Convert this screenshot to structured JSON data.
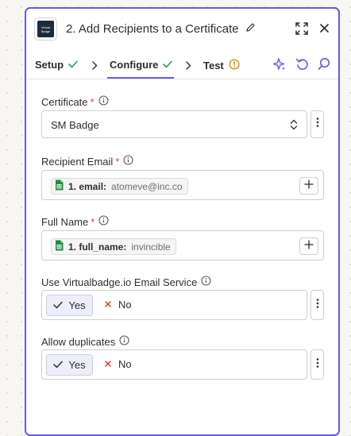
{
  "header": {
    "title": "2. Add Recipients to a Certificate",
    "logo_text_line1": "Virtual",
    "logo_text_line2": "Badge"
  },
  "tabs": [
    {
      "label": "Setup",
      "status": "complete"
    },
    {
      "label": "Configure",
      "status": "complete",
      "active": true
    },
    {
      "label": "Test",
      "status": "warning"
    }
  ],
  "fields": {
    "certificate": {
      "label": "Certificate",
      "required": true,
      "value": "SM Badge"
    },
    "recipient_email": {
      "label": "Recipient Email",
      "required": true,
      "pill_key": "1. email:",
      "pill_value": "atomeve@inc.co"
    },
    "full_name": {
      "label": "Full Name",
      "required": true,
      "pill_key": "1. full_name:",
      "pill_value": "invincible"
    },
    "email_service": {
      "label": "Use Virtualbadge.io Email Service",
      "yes": "Yes",
      "no": "No",
      "selected": "Yes"
    },
    "allow_duplicates": {
      "label": "Allow duplicates",
      "yes": "Yes",
      "no": "No",
      "selected": "Yes"
    }
  },
  "required_marker": "*",
  "colors": {
    "accent": "#6b58e8",
    "success": "#2e9c5a",
    "warning": "#c79a00",
    "required": "#e03e2d",
    "sheets_green": "#1e8e3e"
  }
}
